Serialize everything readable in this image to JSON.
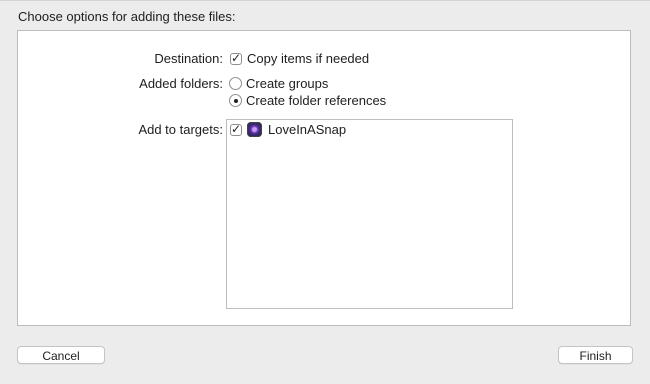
{
  "dialog": {
    "heading": "Choose options for adding these files:",
    "destination": {
      "label": "Destination:",
      "copy_items_label": "Copy items if needed",
      "copy_items_checked": true
    },
    "added_folders": {
      "label": "Added folders:",
      "options": [
        {
          "label": "Create groups",
          "selected": false
        },
        {
          "label": "Create folder references",
          "selected": true
        }
      ]
    },
    "targets": {
      "label": "Add to targets:",
      "items": [
        {
          "name": "LoveInASnap",
          "checked": true,
          "icon": "app-icon"
        }
      ]
    },
    "buttons": {
      "cancel": "Cancel",
      "finish": "Finish"
    }
  }
}
